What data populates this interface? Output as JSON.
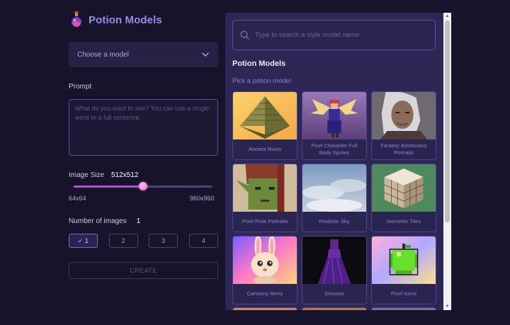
{
  "brand": {
    "title": "Potion Models",
    "icon": "potion-flask-icon"
  },
  "model_select": {
    "label": "Choose a model",
    "icon": "chevron-down-icon"
  },
  "prompt": {
    "label": "Prompt",
    "placeholder": "What do you want to see? You can use a single word or a full sentence."
  },
  "image_size": {
    "label": "Image Size",
    "value": "512x512",
    "min_label": "64x64",
    "max_label": "960x960",
    "slider_fraction": 0.5
  },
  "num_images": {
    "label": "Number of images",
    "value": "1",
    "options": [
      {
        "label": "1",
        "selected": true
      },
      {
        "label": "2",
        "selected": false
      },
      {
        "label": "3",
        "selected": false
      },
      {
        "label": "4",
        "selected": false
      }
    ]
  },
  "create_button": {
    "label": "CREATE"
  },
  "panel": {
    "search_placeholder": "Type to search a style model name",
    "title": "Potion Models",
    "subtitle": "Pick a potion model",
    "models": [
      {
        "label": "Ancient Ruins"
      },
      {
        "label": "Pixel Character Full Body Sprites"
      },
      {
        "label": "Fantasy Aristocracy Portraits"
      },
      {
        "label": "Pixel Pixie Portraits"
      },
      {
        "label": "Realistic Sky"
      },
      {
        "label": "Isometric Tiles"
      },
      {
        "label": "Cartoony Items"
      },
      {
        "label": "Dresses"
      },
      {
        "label": "Pixel Icons"
      }
    ]
  },
  "colors": {
    "background": "#16132a",
    "panel": "#2d2755",
    "accent": "#9c8ce6",
    "slider_fill": "#b54ed8"
  }
}
